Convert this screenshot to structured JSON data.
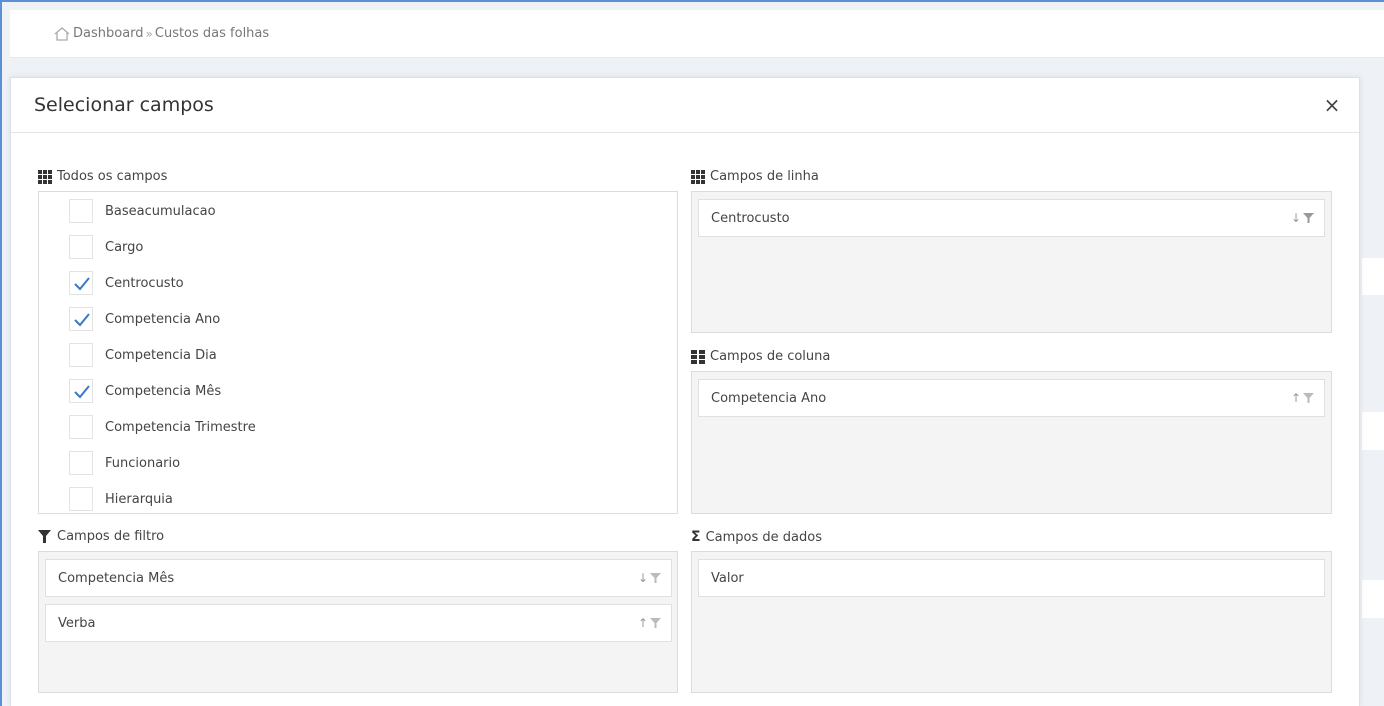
{
  "breadcrumb": {
    "home": "Dashboard",
    "separator": "»",
    "current": "Custos das folhas"
  },
  "modal": {
    "title": "Selecionar campos",
    "close_glyph": "×"
  },
  "all_fields": {
    "label": "Todos os campos",
    "items": [
      {
        "label": "Baseacumulacao",
        "checked": false
      },
      {
        "label": "Cargo",
        "checked": false
      },
      {
        "label": "Centrocusto",
        "checked": true
      },
      {
        "label": "Competencia Ano",
        "checked": true
      },
      {
        "label": "Competencia Dia",
        "checked": false
      },
      {
        "label": "Competencia Mês",
        "checked": true
      },
      {
        "label": "Competencia Trimestre",
        "checked": false
      },
      {
        "label": "Funcionario",
        "checked": false
      },
      {
        "label": "Hierarquia",
        "checked": false
      }
    ]
  },
  "row_fields": {
    "label": "Campos de linha",
    "items": [
      {
        "label": "Centrocusto",
        "arrow": "↓",
        "icon": "filter-icon"
      }
    ]
  },
  "column_fields": {
    "label": "Campos de coluna",
    "items": [
      {
        "label": "Competencia Ano",
        "arrow": "↑",
        "icon": "filter-icon"
      }
    ]
  },
  "filter_fields": {
    "label": "Campos de filtro",
    "items": [
      {
        "label": "Competencia Mês",
        "arrow": "↓",
        "icon": "filter-icon"
      },
      {
        "label": "Verba",
        "arrow": "↑",
        "icon": "filter-icon"
      }
    ]
  },
  "data_fields": {
    "label": "Campos de dados",
    "icon_glyph": "Σ",
    "items": [
      {
        "label": "Valor"
      }
    ]
  },
  "colors": {
    "accent": "#3a77c8",
    "frame": "#5b8fd6",
    "panel": "#f4f4f4"
  }
}
